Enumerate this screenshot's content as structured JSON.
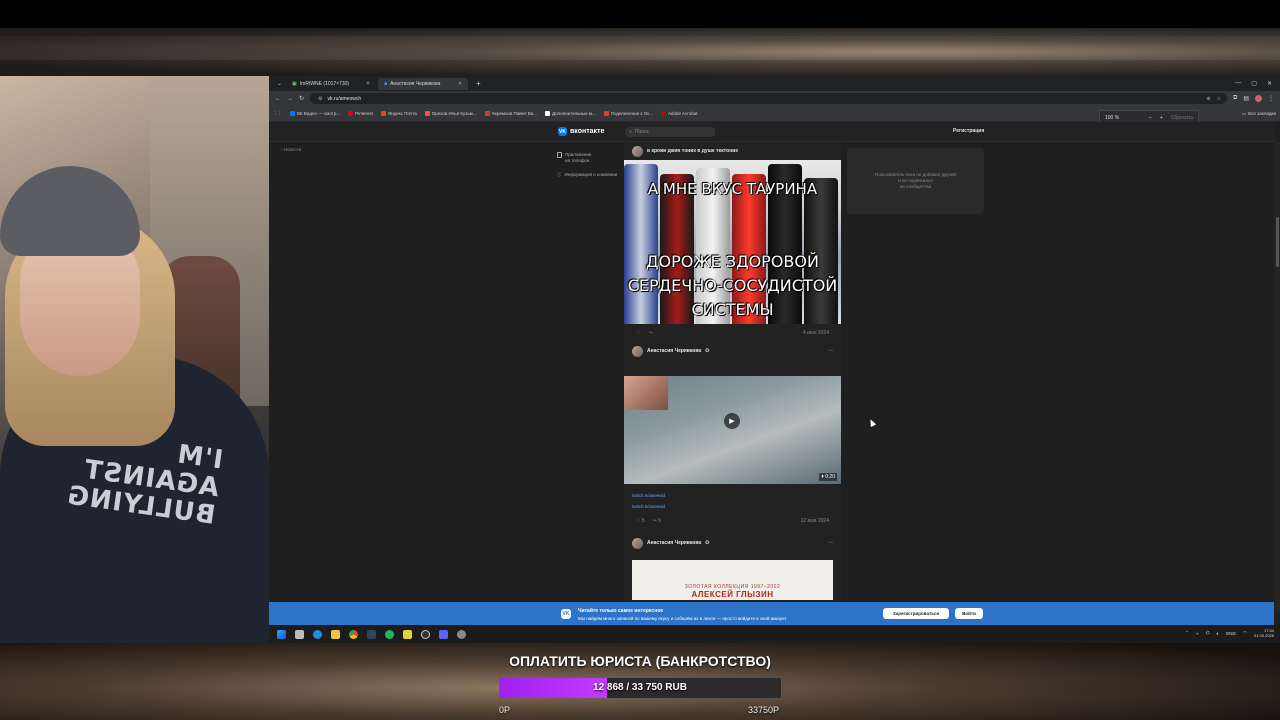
{
  "browser": {
    "tabs": [
      {
        "label": "ImRtWNE (1017×730)"
      },
      {
        "label": "Анастасия Черявкова"
      }
    ],
    "address": "vk.ru/ameowch",
    "zoom": {
      "value": "100 %",
      "reset_label": "Сбросить"
    },
    "bookmarks": [
      {
        "label": "ВК Видео — смотр...",
        "color": "#0077ff"
      },
      {
        "label": "Pinterest",
        "color": "#e60023"
      },
      {
        "label": "Яндекс Почта",
        "color": "#fc3f1d"
      },
      {
        "label": "Орехов Илья Кузьм...",
        "color": "#ff4b4b"
      },
      {
        "label": "Черемхов Павел Ва...",
        "color": "#d23c3c"
      },
      {
        "label": "Дополнительные м...",
        "color": "#ffffff"
      },
      {
        "label": "Подключение к Ок...",
        "color": "#e23b3b"
      },
      {
        "label": "Adobe Acrobat",
        "color": "#b30b00"
      }
    ],
    "all_bookmarks": "Все закладки"
  },
  "vk": {
    "logo": "вконтакте",
    "search_placeholder": "Поиск",
    "register": "Регистрация",
    "news": "Новости",
    "side": {
      "app_line1": "Приложение",
      "app_line2": "на телефон",
      "info": "Информация о компании"
    },
    "post1": {
      "author": "в крови джин тоник в душе тектоник",
      "meme_top": "А МНЕ ВКУС ТАУРИНА",
      "meme_bottom_1": "ДОРОЖЕ ЗДОРОВОЙ",
      "meme_bottom_2": "СЕРДЕЧНО-СОСУДИСТОЙ",
      "meme_bottom_3": "СИСТЕМЫ",
      "date": "4 июн 2024"
    },
    "post2": {
      "author": "Анастасия Черявкова",
      "duration": "0:20",
      "link1": "twitch.tv/aseewd",
      "link2": "twitch.tv/aseewd",
      "likes": "5",
      "shares": "5",
      "date": "12 мая 2024"
    },
    "post3": {
      "author": "Анастасия Черявкова",
      "doc_line1": "ЗОЛОТАЯ КОЛЛЕКЦИЯ 1997–2002",
      "doc_line2": "АЛЕКСЕЙ ГЛЫЗИН"
    },
    "right_card": {
      "line1": "Пользователь пока не добавил друзей",
      "line2": "и не подписался",
      "line3": "на сообщества"
    },
    "banner": {
      "title": "Читайте только самое интересное",
      "subtitle": "Мы найдём много записей по вашему вкусу и соберём их в ленте — просто войдите в свой аккаунт",
      "register_btn": "Зарегистрироваться",
      "login_btn": "Войти"
    }
  },
  "taskbar": {
    "lang": "ENG",
    "time": "17:44",
    "date": "01.05.2026"
  },
  "webcam": {
    "shirt_text": "I'M\nAGAINST\nBULLYING"
  },
  "goal": {
    "title": "ОПЛАТИТЬ ЮРИСТА (БАНКРОТСТВО)",
    "progress_text": "12 868 / 33 750 RUB",
    "current": 12868,
    "target": 33750,
    "min_label": "0Р",
    "max_label": "33750Р",
    "fill_color": "#b02cff"
  }
}
